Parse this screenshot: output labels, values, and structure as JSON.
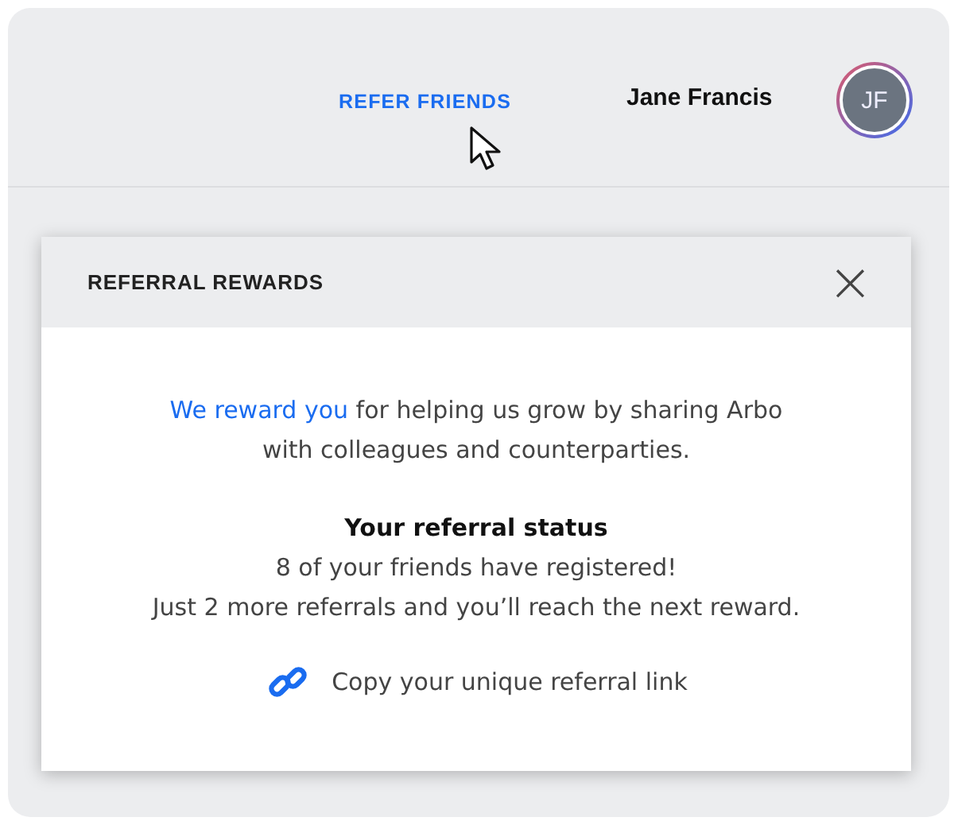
{
  "header": {
    "refer_link": "REFER FRIENDS",
    "user_name": "Jane Francis",
    "avatar_initials": "JF"
  },
  "modal": {
    "title": "REFERRAL REWARDS",
    "close": "×",
    "intro": {
      "link": "We reward you",
      "text": " for helping us grow by sharing Arbo with colleagues and counterparties."
    },
    "status_heading": "Your referral status",
    "status_lines": [
      "8 of your friends have registered!",
      "Just 2 more referrals and you’ll reach the next reward."
    ],
    "copy_link": "Copy your unique referral link"
  }
}
